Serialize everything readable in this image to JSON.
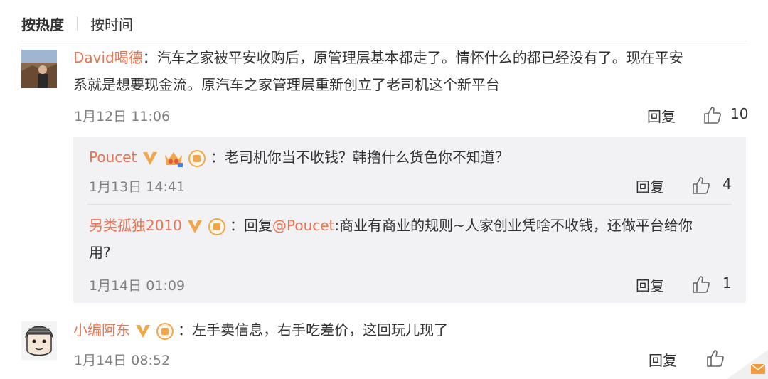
{
  "sort": {
    "active": "按热度",
    "other": "按时间"
  },
  "comments": [
    {
      "user": "David喝德",
      "text_line1": "：汽车之家被平安收购后，原管理层基本都走了。情怀什么的都已经没有了。现在平安",
      "text_line2": "系就是想要现金流。原汽车之家管理层重新创立了老司机这个新平台",
      "time": "1月12日 11:06",
      "reply": "回复",
      "likes": "10"
    },
    {
      "user": "小编阿东",
      "text": "：左手卖信息，右手吃差价，这回玩儿现了",
      "time": "1月14日 08:52",
      "reply": "回复"
    }
  ],
  "replies": [
    {
      "user": "Poucet",
      "text": "：老司机你当不收钱？韩撸什么货色你不知道？",
      "time": "1月13日 14:41",
      "reply": "回复",
      "likes": "4"
    },
    {
      "user": "另类孤独2010",
      "text_prefix": "：回复",
      "mention": "@Poucet",
      "text_line1": ":商业有商业的规则~人家创业凭啥不收钱，还做平台给你",
      "text_line2": "用?",
      "time": "1月14日 01:09",
      "reply": "回复",
      "likes": "1"
    }
  ],
  "colors": {
    "username": "#eb7350",
    "vip": "#f3a54a",
    "reply_bg": "#f2f2f5"
  },
  "icons": [
    "like-icon",
    "vip-badge-icon",
    "member-badge-icon",
    "crown-icon"
  ]
}
